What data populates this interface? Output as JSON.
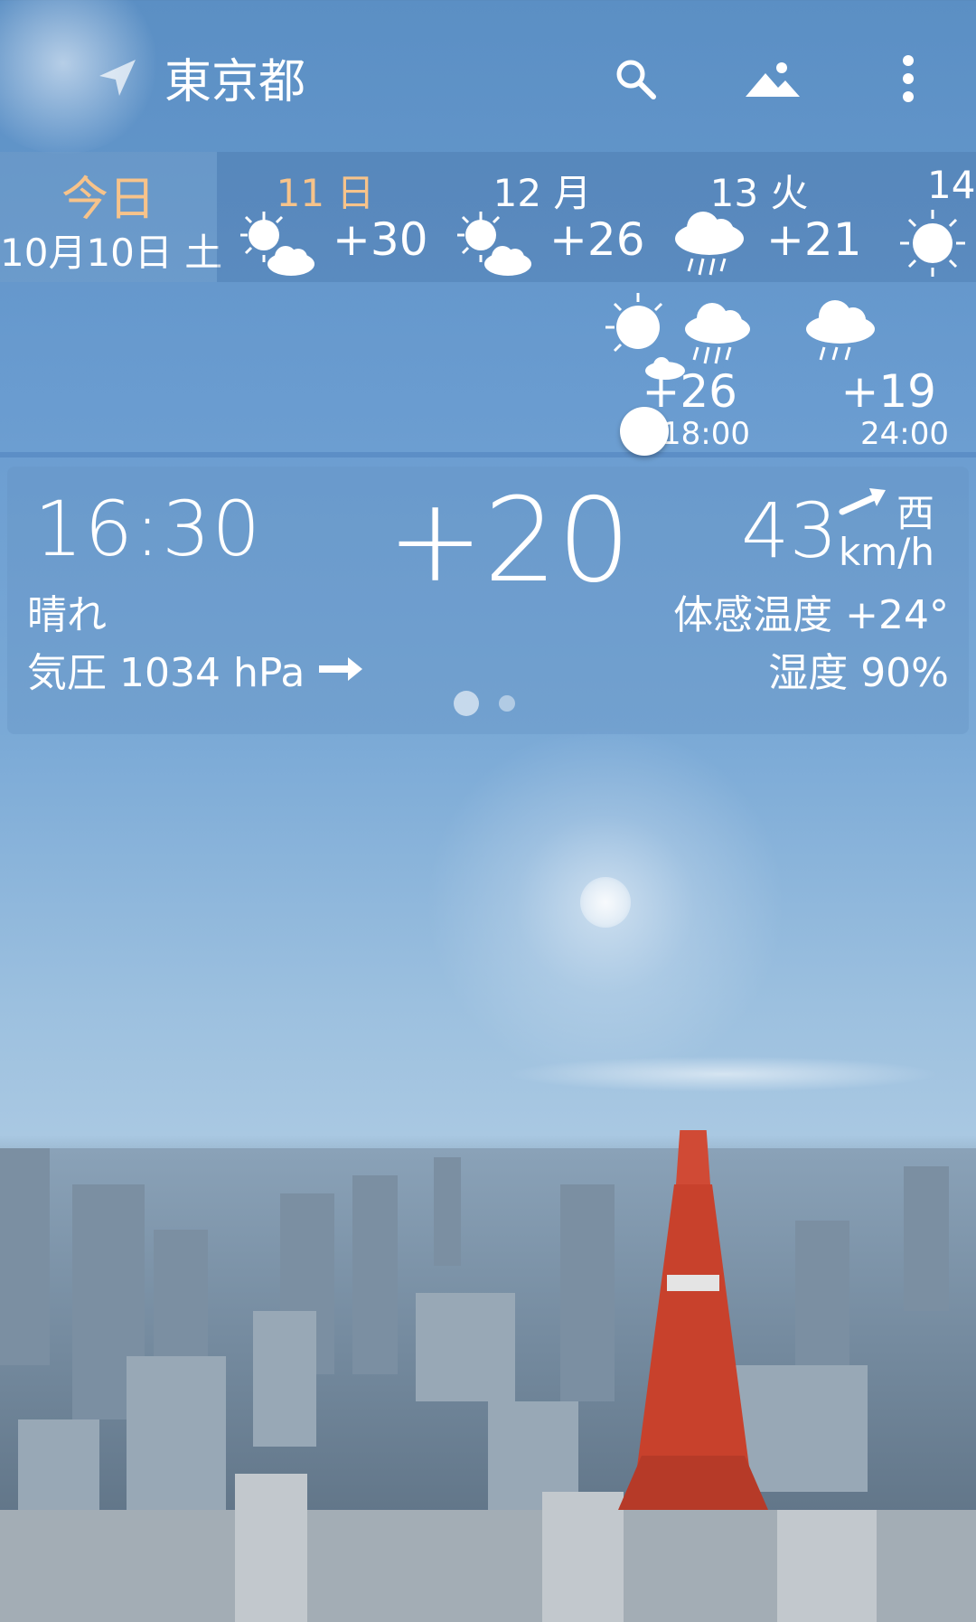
{
  "app_bar": {
    "city": "東京都",
    "icons": [
      "location-arrow-icon",
      "search-icon",
      "landscape-icon",
      "more-vert-icon"
    ]
  },
  "daily": {
    "today": {
      "label": "今日",
      "date": "10月10日 土"
    },
    "days": [
      {
        "label": "11 日",
        "temp": "+30",
        "icon": "sun-cloud-icon",
        "highlight": true
      },
      {
        "label": "12 月",
        "temp": "+26",
        "icon": "sun-cloud-icon",
        "highlight": false
      },
      {
        "label": "13 火",
        "temp": "+21",
        "icon": "rain-icon",
        "highlight": false
      },
      {
        "label": "14",
        "temp": "",
        "icon": "sun-icon",
        "highlight": false
      }
    ]
  },
  "hourly": [
    {
      "time": "18:00",
      "temp": "+26",
      "icon": "sun-rain-icon"
    },
    {
      "time": "24:00",
      "temp": "+19",
      "icon": "rain-icon"
    }
  ],
  "current": {
    "time": "16:30",
    "temp": "+20",
    "wind_speed": "43",
    "wind_dir": "西",
    "wind_unit": "km/h",
    "condition": "晴れ",
    "feels_like": "体感温度 +24°",
    "pressure": "気圧 1034 hPa",
    "humidity": "湿度 90%",
    "pager_pages": 2,
    "pager_active": 0
  },
  "colors": {
    "accent": "#f7c38a",
    "sky": "#6a9cd0"
  }
}
